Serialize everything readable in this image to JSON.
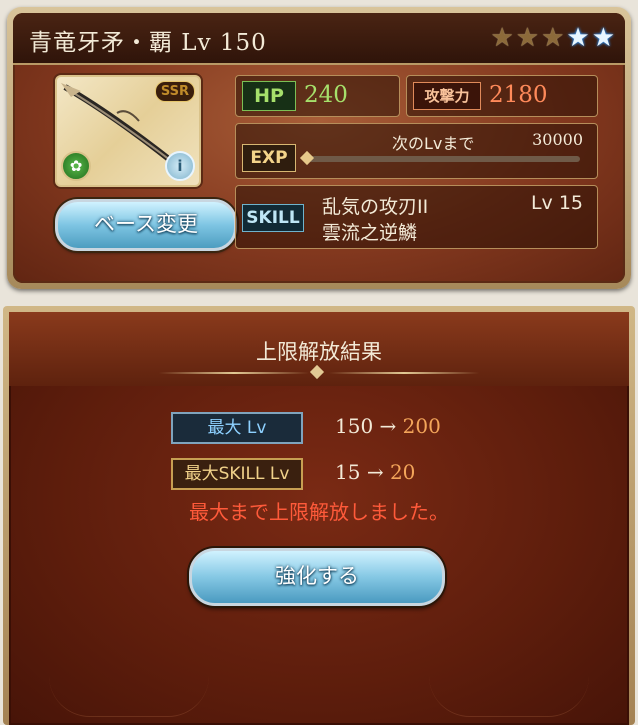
{
  "header": {
    "title": "青竜牙矛・覇 Lv 150",
    "stars": [
      "gold",
      "gold",
      "gold",
      "blue",
      "blue"
    ]
  },
  "weapon": {
    "rarity": "SSR",
    "base_change_label": "ベース変更"
  },
  "stats": {
    "hp_label": "HP",
    "hp": "240",
    "atk_label": "攻撃力",
    "atk": "2180",
    "exp_label": "EXP",
    "exp_next_label": "次のLvまで",
    "exp_next_value": "30000",
    "exp_progress": 0,
    "skill_label": "SKILL",
    "skill_name": "乱気の攻刃II",
    "skill_level": "Lv 15",
    "skill_name_2": "雲流之逆鱗"
  },
  "result": {
    "title": "上限解放結果",
    "max_lv_label": "最大 Lv",
    "max_lv_from": "150",
    "max_lv_to": "200",
    "max_skill_label": "最大SKILL Lv",
    "max_skill_from": "15",
    "max_skill_to": "20",
    "arrow": "→",
    "message": "最大まで上限解放しました。",
    "enhance_label": "強化する"
  },
  "colors": {
    "hp": "#a6e06b",
    "atk": "#ff8a5a",
    "message": "#ff5a3a",
    "new_value": "#f3a55a",
    "button": "#85c8e4"
  }
}
